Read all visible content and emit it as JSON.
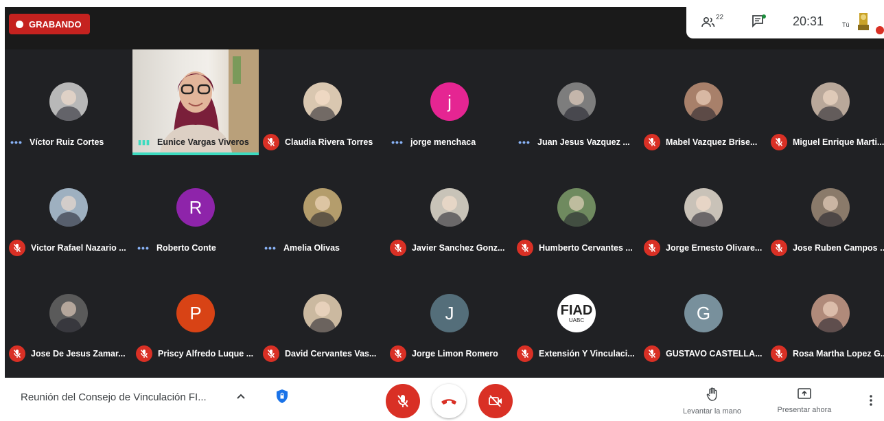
{
  "recording": {
    "label": "GRABANDO"
  },
  "info_bar": {
    "people_count": "22",
    "time": "20:31",
    "you_label": "Tú"
  },
  "participants": [
    {
      "name": "Víctor Ruiz Cortes",
      "status": "dots",
      "avatar": {
        "kind": "photo",
        "color": "#b8b8b8"
      }
    },
    {
      "name": "Eunice Vargas Viveros",
      "status": "speaking",
      "avatar": {
        "kind": "video"
      }
    },
    {
      "name": "Claudia Rivera Torres",
      "status": "muted",
      "avatar": {
        "kind": "photo",
        "color": "#d9c7b0"
      }
    },
    {
      "name": "jorge menchaca",
      "status": "dots",
      "avatar": {
        "kind": "letter",
        "letter": "j",
        "color": "#e52592"
      }
    },
    {
      "name": "Juan Jesus Vazquez ...",
      "status": "dots",
      "avatar": {
        "kind": "photo",
        "color": "#7d7d7d"
      }
    },
    {
      "name": "Mabel Vazquez Brise...",
      "status": "muted",
      "avatar": {
        "kind": "photo",
        "color": "#a8806a"
      }
    },
    {
      "name": "Miguel Enrique Marti...",
      "status": "muted",
      "avatar": {
        "kind": "photo",
        "color": "#b9a89a"
      }
    },
    {
      "name": "Victor Rafael Nazario ...",
      "status": "muted",
      "avatar": {
        "kind": "photo",
        "color": "#9eb0c0"
      }
    },
    {
      "name": "Roberto Conte",
      "status": "dots",
      "avatar": {
        "kind": "letter",
        "letter": "R",
        "color": "#8e24aa"
      }
    },
    {
      "name": "Amelia Olivas",
      "status": "dots",
      "avatar": {
        "kind": "photo",
        "color": "#b49d6c"
      }
    },
    {
      "name": "Javier Sanchez Gonz...",
      "status": "muted",
      "avatar": {
        "kind": "photo",
        "color": "#c8c3b8"
      }
    },
    {
      "name": "Humberto Cervantes ...",
      "status": "muted",
      "avatar": {
        "kind": "photo",
        "color": "#6f8a5f"
      }
    },
    {
      "name": "Jorge Ernesto Olivare...",
      "status": "muted",
      "avatar": {
        "kind": "photo",
        "color": "#c9c2b8"
      }
    },
    {
      "name": "Jose Ruben Campos ...",
      "status": "muted",
      "avatar": {
        "kind": "photo",
        "color": "#8a7a6a"
      }
    },
    {
      "name": "Jose De Jesus Zamar...",
      "status": "muted",
      "avatar": {
        "kind": "photo",
        "color": "#5a5a5a"
      }
    },
    {
      "name": "Priscy Alfredo Luque ...",
      "status": "muted",
      "avatar": {
        "kind": "letter",
        "letter": "P",
        "color": "#d84315"
      }
    },
    {
      "name": "David Cervantes Vas...",
      "status": "muted",
      "avatar": {
        "kind": "photo",
        "color": "#cbb9a0"
      }
    },
    {
      "name": "Jorge Limon Romero",
      "status": "muted",
      "avatar": {
        "kind": "letter",
        "letter": "J",
        "color": "#546e7a"
      }
    },
    {
      "name": "Extensión Y Vinculaci...",
      "status": "muted",
      "avatar": {
        "kind": "logo",
        "text": "FIAD",
        "subtext": "UABC",
        "color": "#ffffff"
      }
    },
    {
      "name": "GUSTAVO CASTELLA...",
      "status": "muted",
      "avatar": {
        "kind": "letter",
        "letter": "G",
        "color": "#78909c"
      }
    },
    {
      "name": "Rosa Martha Lopez G...",
      "status": "muted",
      "avatar": {
        "kind": "photo",
        "color": "#b08a7a"
      }
    }
  ],
  "bottom_bar": {
    "meeting_title": "Reunión del Consejo de Vinculación FI...",
    "raise_hand_label": "Levantar la mano",
    "present_now_label": "Presentar ahora"
  },
  "colors": {
    "danger": "#d93025",
    "speaking_indicator": "#3cdbc0",
    "grid_bg": "#202124"
  }
}
